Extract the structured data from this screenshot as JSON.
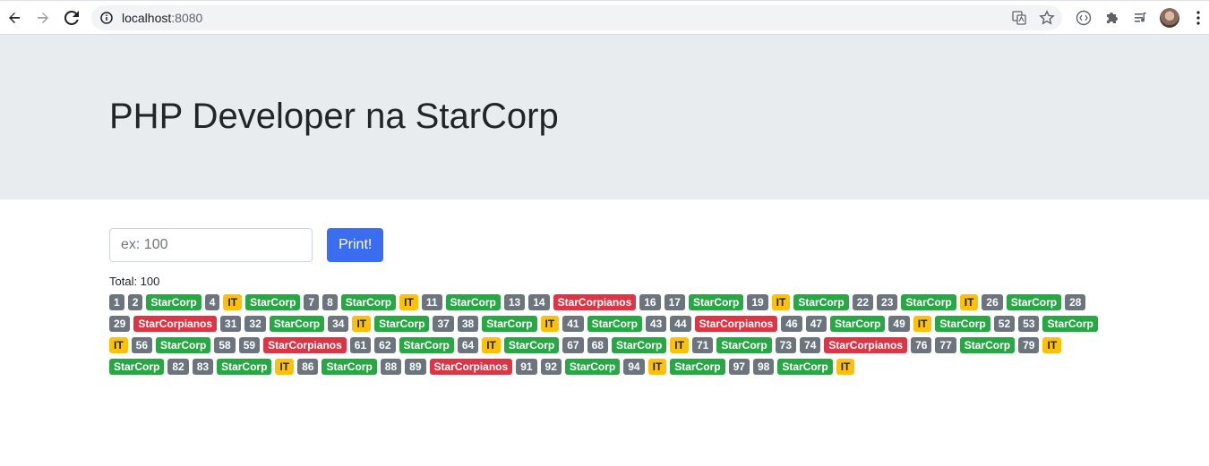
{
  "browser": {
    "url_host": "localhost",
    "url_port": ":8080"
  },
  "header": {
    "title": "PHP Developer na StarCorp"
  },
  "form": {
    "input_placeholder": "ex: 100",
    "input_value": "",
    "button_label": "Print!"
  },
  "total_label": "Total: 100",
  "badges": [
    "1",
    "2",
    "StarCorp",
    "4",
    "IT",
    "StarCorp",
    "7",
    "8",
    "StarCorp",
    "IT",
    "11",
    "StarCorp",
    "13",
    "14",
    "StarCorpianos",
    "16",
    "17",
    "StarCorp",
    "19",
    "IT",
    "StarCorp",
    "22",
    "23",
    "StarCorp",
    "IT",
    "26",
    "StarCorp",
    "28",
    "29",
    "StarCorpianos",
    "31",
    "32",
    "StarCorp",
    "34",
    "IT",
    "StarCorp",
    "37",
    "38",
    "StarCorp",
    "IT",
    "41",
    "StarCorp",
    "43",
    "44",
    "StarCorpianos",
    "46",
    "47",
    "StarCorp",
    "49",
    "IT",
    "StarCorp",
    "52",
    "53",
    "StarCorp",
    "IT",
    "56",
    "StarCorp",
    "58",
    "59",
    "StarCorpianos",
    "61",
    "62",
    "StarCorp",
    "64",
    "IT",
    "StarCorp",
    "67",
    "68",
    "StarCorp",
    "IT",
    "71",
    "StarCorp",
    "73",
    "74",
    "StarCorpianos",
    "76",
    "77",
    "StarCorp",
    "79",
    "IT",
    "StarCorp",
    "82",
    "83",
    "StarCorp",
    "IT",
    "86",
    "StarCorp",
    "88",
    "89",
    "StarCorpianos",
    "91",
    "92",
    "StarCorp",
    "94",
    "IT",
    "StarCorp",
    "97",
    "98",
    "StarCorp",
    "IT"
  ],
  "colors": {
    "number": "#6c757d",
    "StarCorp": "#28a745",
    "IT": "#ffc107",
    "StarCorpianos": "#dc3545",
    "primary": "#3a6df0",
    "jumbotron": "#e9ecef"
  }
}
